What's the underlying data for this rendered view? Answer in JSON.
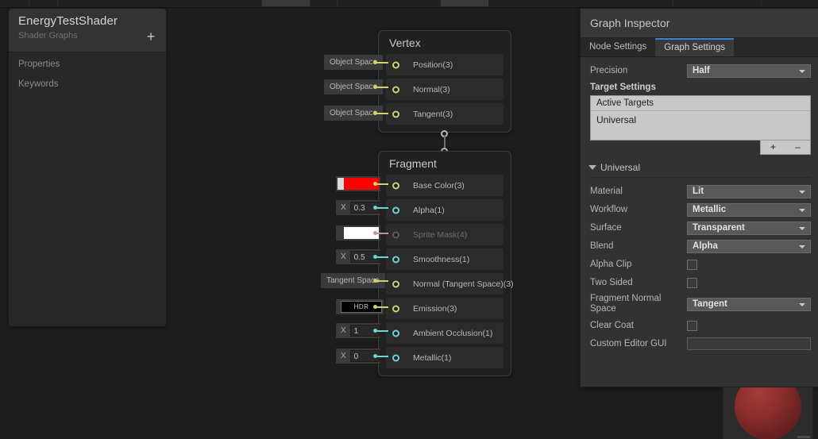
{
  "blackboard": {
    "title": "EnergyTestShader",
    "subtitle": "Shader Graphs",
    "add_label": "+",
    "sections": [
      "Properties",
      "Keywords"
    ]
  },
  "graph": {
    "vertex_node": {
      "title": "Vertex",
      "slots": [
        {
          "label": "Position(3)",
          "prop_type": "space",
          "prop_value": "Object Space",
          "port": "v3"
        },
        {
          "label": "Normal(3)",
          "prop_type": "space",
          "prop_value": "Object Space",
          "port": "v3"
        },
        {
          "label": "Tangent(3)",
          "prop_type": "space",
          "prop_value": "Object Space",
          "port": "v3"
        }
      ]
    },
    "fragment_node": {
      "title": "Fragment",
      "slots": [
        {
          "label": "Base Color(3)",
          "prop_type": "color",
          "prop_value": "#ff0000",
          "port": "v3",
          "disabled": false
        },
        {
          "label": "Alpha(1)",
          "prop_type": "number",
          "axis_label": "X",
          "prop_value": "0.3",
          "port": "v1",
          "disabled": false
        },
        {
          "label": "Sprite Mask(4)",
          "prop_type": "color",
          "prop_value": "#ffffff",
          "port": "v4",
          "disabled": true
        },
        {
          "label": "Smoothness(1)",
          "prop_type": "number",
          "axis_label": "X",
          "prop_value": "0.5",
          "port": "v1",
          "disabled": false
        },
        {
          "label": "Normal (Tangent Space)(3)",
          "prop_type": "space",
          "prop_value": "Tangent Space",
          "port": "v3",
          "disabled": false
        },
        {
          "label": "Emission(3)",
          "prop_type": "hdr",
          "prop_value": "HDR",
          "port": "v3",
          "disabled": false
        },
        {
          "label": "Ambient Occlusion(1)",
          "prop_type": "number",
          "axis_label": "X",
          "prop_value": "1",
          "port": "v1",
          "disabled": false
        },
        {
          "label": "Metallic(1)",
          "prop_type": "number",
          "axis_label": "X",
          "prop_value": "0",
          "port": "v1",
          "disabled": false
        }
      ]
    },
    "port_colors": {
      "vector3": "#cfd36a",
      "vector1": "#6fd4d4",
      "vector4": "#c98bb8",
      "disabled": "#5c5c5c"
    }
  },
  "inspector": {
    "title": "Graph Inspector",
    "tabs": [
      {
        "label": "Node Settings",
        "active": false
      },
      {
        "label": "Graph Settings",
        "active": true
      }
    ],
    "accent_color": "#3b7fd4",
    "precision": {
      "label": "Precision",
      "value": "Half"
    },
    "target_settings_title": "Target Settings",
    "active_targets": {
      "header": "Active Targets",
      "items": [
        "Universal"
      ],
      "add_button": "+",
      "remove_button": "–"
    },
    "universal": {
      "foldout_label": "Universal",
      "rows": [
        {
          "label": "Material",
          "type": "dropdown",
          "value": "Lit"
        },
        {
          "label": "Workflow",
          "type": "dropdown",
          "value": "Metallic"
        },
        {
          "label": "Surface",
          "type": "dropdown",
          "value": "Transparent"
        },
        {
          "label": "Blend",
          "type": "dropdown",
          "value": "Alpha"
        },
        {
          "label": "Alpha Clip",
          "type": "checkbox",
          "value": false
        },
        {
          "label": "Two Sided",
          "type": "checkbox",
          "value": false
        },
        {
          "label": "Fragment Normal Space",
          "type": "dropdown",
          "value": "Tangent"
        },
        {
          "label": "Clear Coat",
          "type": "checkbox",
          "value": false
        },
        {
          "label": "Custom Editor GUI",
          "type": "text",
          "value": ""
        }
      ]
    }
  },
  "preview": {
    "material_color": "#8e2e2e"
  }
}
